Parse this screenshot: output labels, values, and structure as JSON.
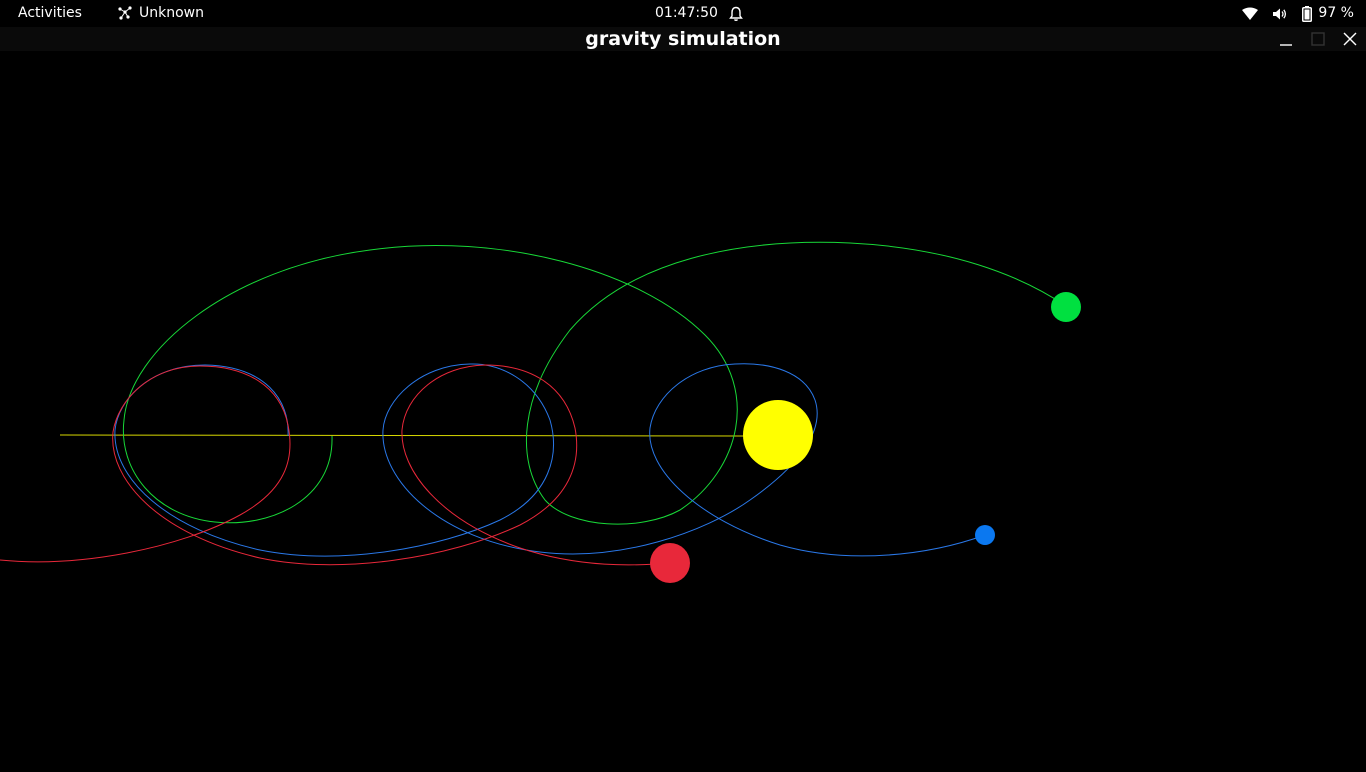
{
  "topbar": {
    "activities_label": "Activities",
    "app_name": "Unknown",
    "clock": "01:47:50",
    "battery_percent": "97 %"
  },
  "window": {
    "title": "gravity simulation"
  },
  "simulation": {
    "bodies": [
      {
        "name": "sun",
        "color": "#ffff00"
      },
      {
        "name": "red-planet",
        "color": "#e8283a"
      },
      {
        "name": "blue-planet",
        "color": "#0b78f0"
      },
      {
        "name": "green-planet",
        "color": "#00e040"
      }
    ],
    "trail_colors": {
      "red": "#e8283a",
      "blue": "#2a78e8",
      "green": "#18d838",
      "yellow": "#d8d800"
    }
  }
}
